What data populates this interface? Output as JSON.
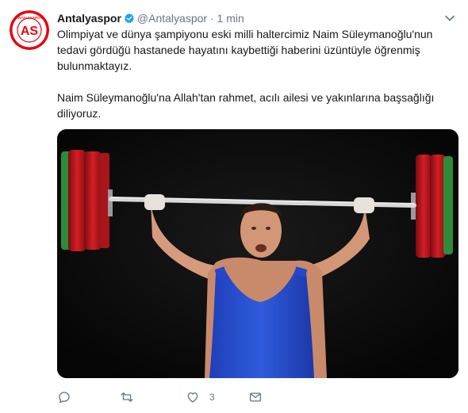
{
  "tweet": {
    "author": {
      "name": "Antalyaspor",
      "handle": "@Antalyaspor",
      "verified": true,
      "avatar_text": "ANTALYASPOR",
      "avatar_letters": "AS"
    },
    "separator": "·",
    "time": "1 min",
    "paragraphs": [
      "Olimpiyat ve dünya şampiyonu eski milli haltercimiz Naim Süleymanoğlu'nun tedavi gördüğü hastanede hayatını kaybettiği haberini üzüntüyle öğrenmiş bulunmaktayız.",
      "Naim Süleymanoğlu'na Allah'tan rahmet, acılı ailesi ve yakınlarına başsağlığı diliyoruz."
    ],
    "actions": {
      "reply_count": "",
      "retweet_count": "",
      "like_count": "3",
      "message_count": ""
    },
    "icons": [
      "chevron-down-icon",
      "reply-icon",
      "retweet-icon",
      "heart-icon",
      "envelope-icon",
      "verified-badge-icon"
    ],
    "colors": {
      "verified": "#1da1f2",
      "brand_red": "#e30613",
      "muted": "#657786",
      "text": "#14171a"
    }
  }
}
